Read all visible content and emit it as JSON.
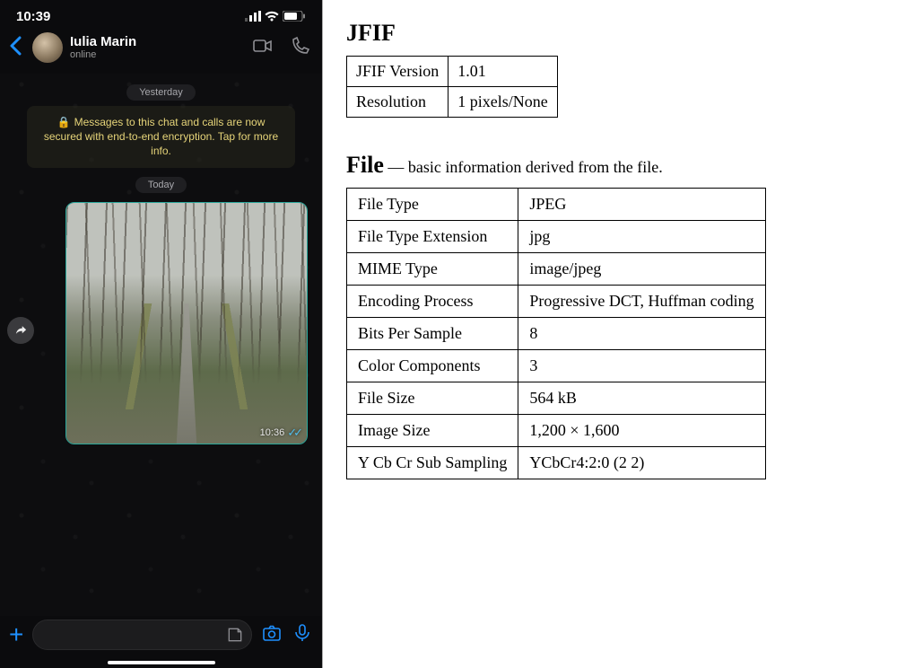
{
  "status": {
    "time": "10:39"
  },
  "chat": {
    "contact_name": "Iulia  Marin",
    "status": "online",
    "day1": "Yesterday",
    "encryption_notice": "Messages to this chat and calls are now secured with end-to-end encryption. Tap for more info.",
    "day2": "Today",
    "msg_time": "10:36"
  },
  "meta": {
    "jfif_heading": "JFIF",
    "jfif": [
      {
        "k": "JFIF Version",
        "v": "1.01"
      },
      {
        "k": "Resolution",
        "v": "1 pixels/None"
      }
    ],
    "file_heading": "File",
    "file_sub": " — basic information derived from the file.",
    "file": [
      {
        "k": "File Type",
        "v": "JPEG"
      },
      {
        "k": "File Type Extension",
        "v": "jpg"
      },
      {
        "k": "MIME Type",
        "v": "image/jpeg"
      },
      {
        "k": "Encoding Process",
        "v": "Progressive DCT, Huffman coding"
      },
      {
        "k": "Bits Per Sample",
        "v": "8"
      },
      {
        "k": "Color Components",
        "v": "3"
      },
      {
        "k": "File Size",
        "v": "564 kB"
      },
      {
        "k": "Image Size",
        "v": "1,200 × 1,600"
      },
      {
        "k": "Y Cb Cr Sub Sampling",
        "v": "YCbCr4:2:0 (2 2)"
      }
    ]
  }
}
